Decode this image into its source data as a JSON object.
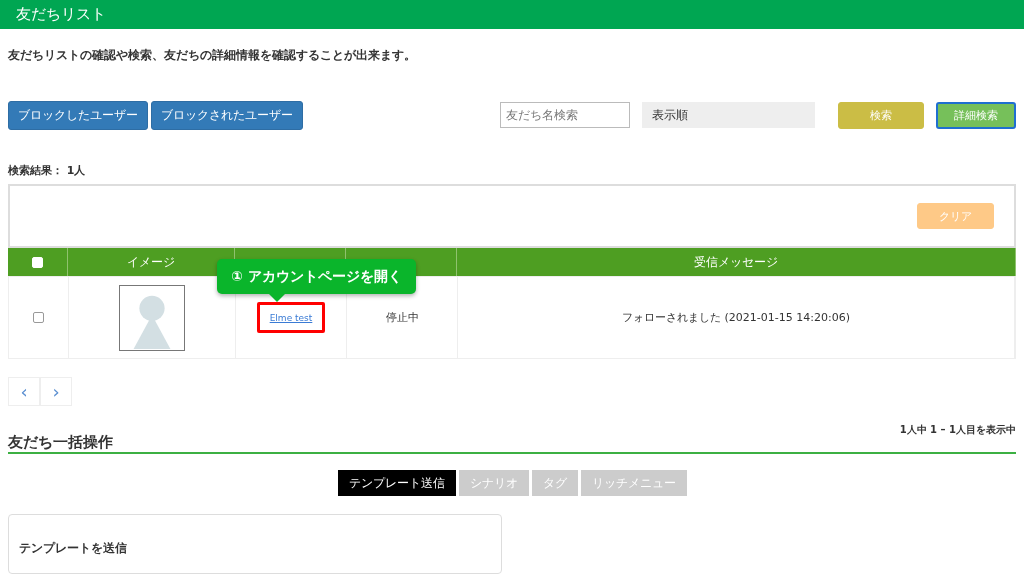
{
  "header": {
    "title": "友だちリスト"
  },
  "description": "友だちリストの確認や検索、友だちの詳細情報を確認することが出来ます。",
  "block_buttons": [
    "ブロックしたユーザー",
    "ブロックされたユーザー"
  ],
  "search": {
    "placeholder": "友だち名検索",
    "sort_value": "表示順",
    "search_button": "検索",
    "detail_button": "詳細検索"
  },
  "result_count": "検索結果： 1人",
  "filter": {
    "clear_button": "クリア"
  },
  "table": {
    "header_checked": false,
    "columns": [
      "イメージ",
      "受信メッセージ"
    ],
    "rows": [
      {
        "checked": false,
        "name": "Elme test",
        "scenario": "停止中",
        "message": "フォローされました (2021-01-15 14:20:06)"
      }
    ]
  },
  "callout": "① アカウントページを開く",
  "pagination": {
    "prev": "‹",
    "next": "›",
    "summary": "1人中 1 – 1人目を表示中"
  },
  "bulk": {
    "title": "友だち一括操作",
    "tabs": [
      {
        "label": "テンプレート送信",
        "selected": true
      },
      {
        "label": "シナリオ",
        "selected": false
      },
      {
        "label": "タグ",
        "selected": false
      },
      {
        "label": "リッチメニュー",
        "selected": false
      }
    ],
    "card_title": "テンプレートを送信"
  }
}
